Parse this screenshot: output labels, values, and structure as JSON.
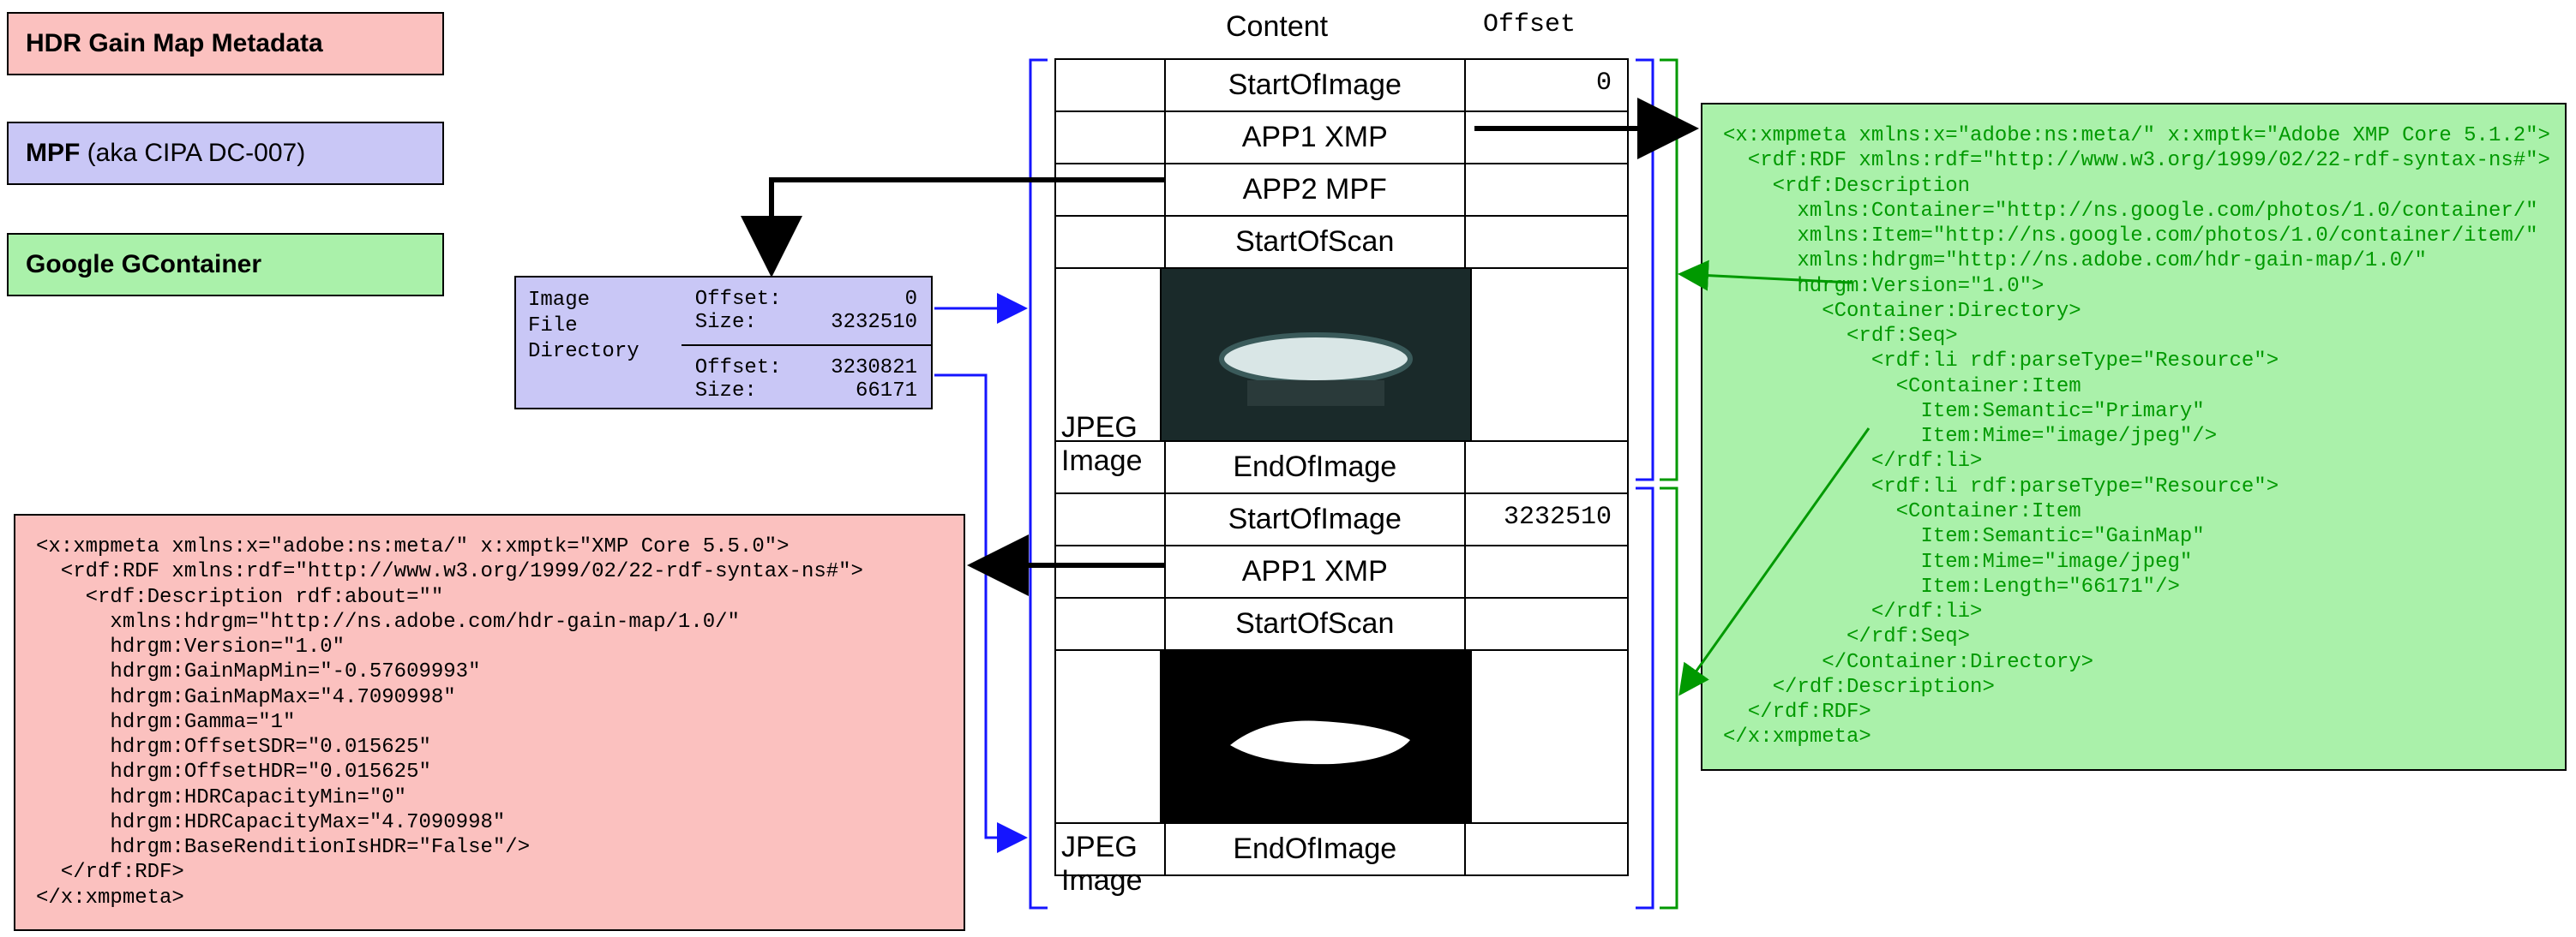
{
  "legend": {
    "hdr": "HDR Gain Map Metadata",
    "mpf_bold": "MPF",
    "mpf_rest": " (aka CIPA DC-007)",
    "gcont": "Google GContainer"
  },
  "headers": {
    "content": "Content",
    "offset": "Offset"
  },
  "ifd": {
    "title": "Image\nFile\nDirectory",
    "r0": "Offset:          0\nSize:      3232510",
    "r1": "Offset:    3230821\nSize:        66171"
  },
  "stack": {
    "soi": "StartOfImage",
    "app1": "APP1 XMP",
    "app2": "APP2 MPF",
    "sos": "StartOfScan",
    "eoi": "EndOfImage",
    "jpeg": "JPEG\nImage",
    "off0": "0",
    "off1": "3232510"
  },
  "xmp_green": "<x:xmpmeta xmlns:x=\"adobe:ns:meta/\" x:xmptk=\"Adobe XMP Core 5.1.2\">\n  <rdf:RDF xmlns:rdf=\"http://www.w3.org/1999/02/22-rdf-syntax-ns#\">\n    <rdf:Description\n      xmlns:Container=\"http://ns.google.com/photos/1.0/container/\"\n      xmlns:Item=\"http://ns.google.com/photos/1.0/container/item/\"\n      xmlns:hdrgm=\"http://ns.adobe.com/hdr-gain-map/1.0/\"\n      hdrgm:Version=\"1.0\">\n        <Container:Directory>\n          <rdf:Seq>\n            <rdf:li rdf:parseType=\"Resource\">\n              <Container:Item\n                Item:Semantic=\"Primary\"\n                Item:Mime=\"image/jpeg\"/>\n            </rdf:li>\n            <rdf:li rdf:parseType=\"Resource\">\n              <Container:Item\n                Item:Semantic=\"GainMap\"\n                Item:Mime=\"image/jpeg\"\n                Item:Length=\"66171\"/>\n            </rdf:li>\n          </rdf:Seq>\n        </Container:Directory>\n    </rdf:Description>\n  </rdf:RDF>\n</x:xmpmeta>",
  "xmp_pink": "<x:xmpmeta xmlns:x=\"adobe:ns:meta/\" x:xmptk=\"XMP Core 5.5.0\">\n  <rdf:RDF xmlns:rdf=\"http://www.w3.org/1999/02/22-rdf-syntax-ns#\">\n    <rdf:Description rdf:about=\"\"\n      xmlns:hdrgm=\"http://ns.adobe.com/hdr-gain-map/1.0/\"\n      hdrgm:Version=\"1.0\"\n      hdrgm:GainMapMin=\"-0.57609993\"\n      hdrgm:GainMapMax=\"4.7090998\"\n      hdrgm:Gamma=\"1\"\n      hdrgm:OffsetSDR=\"0.015625\"\n      hdrgm:OffsetHDR=\"0.015625\"\n      hdrgm:HDRCapacityMin=\"0\"\n      hdrgm:HDRCapacityMax=\"4.7090998\"\n      hdrgm:BaseRenditionIsHDR=\"False\"/>\n  </rdf:RDF>\n</x:xmpmeta>"
}
